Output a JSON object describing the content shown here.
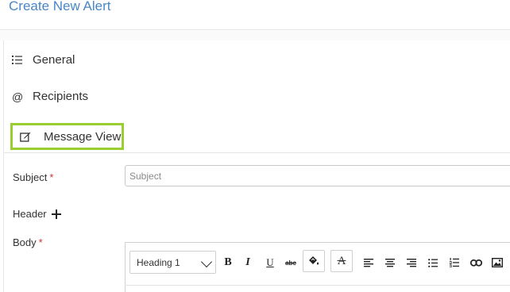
{
  "page": {
    "title": "Create New Alert"
  },
  "nav": {
    "items": [
      {
        "label": "General",
        "icon": "list-icon"
      },
      {
        "label": "Recipients",
        "icon": "at-icon"
      },
      {
        "label": "Message View",
        "icon": "edit-icon",
        "active": true
      }
    ],
    "active_color": "#9acd32"
  },
  "form": {
    "subject_label": "Subject",
    "required_mark": "*",
    "subject_placeholder": "Subject",
    "subject_value": "",
    "header_label": "Header",
    "body_label": "Body"
  },
  "editor": {
    "format_value": "Heading 1",
    "buttons": [
      {
        "name": "bold",
        "glyph": "B"
      },
      {
        "name": "italic",
        "glyph": "I"
      },
      {
        "name": "underline",
        "glyph": "U"
      },
      {
        "name": "strikethrough",
        "glyph": "abc"
      },
      {
        "name": "text-color",
        "glyph": "◆"
      },
      {
        "name": "clear-format",
        "glyph": "A"
      }
    ]
  },
  "colors": {
    "title": "#4a86c5",
    "required": "#cc3333"
  }
}
